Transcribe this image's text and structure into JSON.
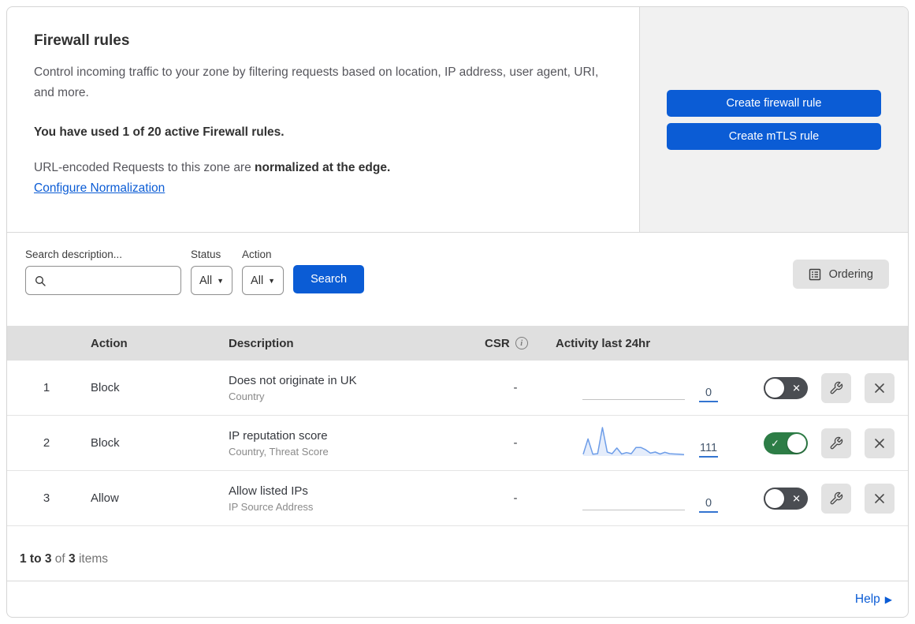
{
  "header": {
    "title": "Firewall rules",
    "description": "Control incoming traffic to your zone by filtering requests based on location, IP address, user agent, URI, and more.",
    "usage_line": "You have used 1 of 20 active Firewall rules.",
    "normalization_prefix": "URL-encoded Requests to this zone are ",
    "normalization_bold": "normalized at the edge.",
    "normalization_link": "Configure Normalization",
    "create_firewall_button": "Create firewall rule",
    "create_mtls_button": "Create mTLS rule"
  },
  "filters": {
    "search_label": "Search description...",
    "search_value": "",
    "status_label": "Status",
    "status_value": "All",
    "action_label": "Action",
    "action_value": "All",
    "search_button": "Search",
    "ordering_button": "Ordering"
  },
  "table": {
    "columns": {
      "action": "Action",
      "description": "Description",
      "csr": "CSR",
      "activity": "Activity last 24hr"
    },
    "rows": [
      {
        "priority": "1",
        "action": "Block",
        "description": "Does not originate in UK",
        "criteria": "Country",
        "csr": "-",
        "activity_count": "0",
        "enabled": false,
        "sparkline": null
      },
      {
        "priority": "2",
        "action": "Block",
        "description": "IP reputation score",
        "criteria": "Country, Threat Score",
        "csr": "-",
        "activity_count": "111",
        "enabled": true,
        "sparkline": [
          6,
          60,
          6,
          8,
          100,
          14,
          8,
          28,
          7,
          12,
          8,
          30,
          30,
          22,
          10,
          14,
          7,
          13,
          8,
          7,
          6,
          5
        ]
      },
      {
        "priority": "3",
        "action": "Allow",
        "description": "Allow listed IPs",
        "criteria": "IP Source Address",
        "csr": "-",
        "activity_count": "0",
        "enabled": false,
        "sparkline": null
      }
    ]
  },
  "footer": {
    "range": "1 to 3",
    "of_text": " of ",
    "total": "3",
    "items_text": " items",
    "help_label": "Help"
  },
  "colors": {
    "accent_blue": "#0b5cd5",
    "toggle_on_green": "#2d7d46",
    "toggle_off_gray": "#4a4d52",
    "sparkline_blue": "#6d9de8",
    "header_gray": "#dfdfdf",
    "panel_gray": "#f1f1f1"
  }
}
